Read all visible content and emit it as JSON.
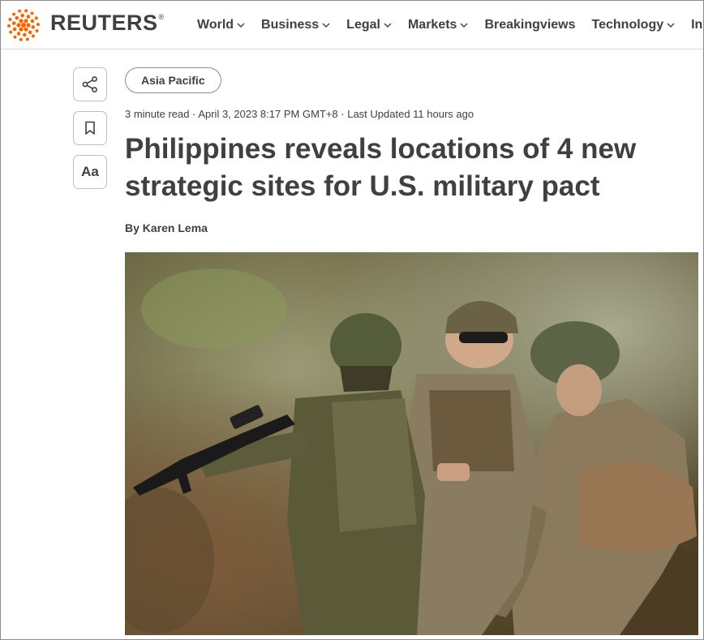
{
  "brand": {
    "name": "REUTERS",
    "registered": "®",
    "accent_color": "#fa6400"
  },
  "nav": {
    "items": [
      {
        "label": "World",
        "has_dropdown": true
      },
      {
        "label": "Business",
        "has_dropdown": true
      },
      {
        "label": "Legal",
        "has_dropdown": true
      },
      {
        "label": "Markets",
        "has_dropdown": true
      },
      {
        "label": "Breakingviews",
        "has_dropdown": false
      },
      {
        "label": "Technology",
        "has_dropdown": true
      },
      {
        "label": "Investiga",
        "has_dropdown": false
      }
    ]
  },
  "rail": {
    "share_icon": "share-icon",
    "bookmark_icon": "bookmark-icon",
    "text_size_label": "Aa"
  },
  "article": {
    "section_tag": "Asia Pacific",
    "meta": "3 minute read · April 3, 2023 8:17 PM GMT+8 · Last Updated 11 hours ago",
    "headline": "Philippines reveals locations of 4 new strategic sites for U.S. military pact",
    "byline_prefix": "By",
    "author": "Karen Lema",
    "photo_subject": "soldiers in camouflage with rifle"
  }
}
